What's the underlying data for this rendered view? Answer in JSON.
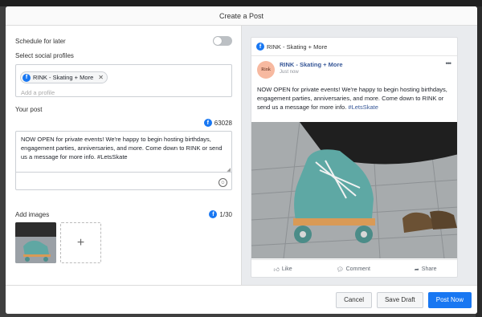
{
  "modal": {
    "title": "Create a Post"
  },
  "schedule": {
    "label": "Schedule for later",
    "enabled": false
  },
  "profiles": {
    "label": "Select social profiles",
    "chip": "RINK - Skating + More",
    "placeholder": "Add a profile"
  },
  "post": {
    "label": "Your post",
    "char_count": "63028",
    "text": "NOW OPEN for private events! We're happy to begin hosting birthdays, engagement parties, anniversaries, and more. Come down to RINK or send us a message for more info. #LetsSkate"
  },
  "images": {
    "label": "Add images",
    "count": "1/30"
  },
  "preview": {
    "account": "RINK - Skating + More",
    "page_name": "RINK - Skating + More",
    "time": "Just now",
    "avatar_text": "Rink",
    "text_main": "NOW OPEN for private events! We're happy to begin hosting birthdays, engagement parties, anniversaries, and more. Come down to RINK or send us a message for more info.",
    "hashtag": "#LetsSkate",
    "actions": {
      "like": "Like",
      "comment": "Comment",
      "share": "Share"
    }
  },
  "footer": {
    "cancel": "Cancel",
    "save_draft": "Save Draft",
    "post_now": "Post Now"
  },
  "colors": {
    "brand": "#1877f2",
    "link": "#385898"
  }
}
